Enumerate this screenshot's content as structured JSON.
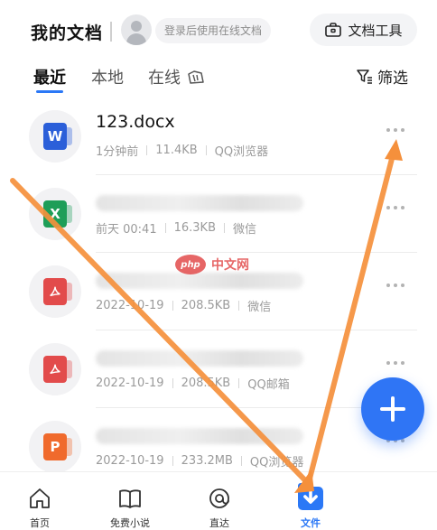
{
  "header": {
    "title": "我的文档",
    "login_prompt": "登录后使用在线文档",
    "tools_label": "文档工具"
  },
  "tabs": {
    "recent": "最近",
    "local": "本地",
    "online": "在线",
    "filter_label": "筛选"
  },
  "files": [
    {
      "icon": "word-doc-icon",
      "type_letter": "W",
      "color": "#2b5fd9",
      "name": "123.docx",
      "time": "1分钟前",
      "size": "11.4KB",
      "source": "QQ浏览器"
    },
    {
      "icon": "excel-sheet-icon",
      "type_letter": "X",
      "color": "#1e9e58",
      "name": "",
      "time": "前天 00:41",
      "size": "16.3KB",
      "source": "微信"
    },
    {
      "icon": "pdf-file-icon",
      "type_letter": "",
      "color": "#e24b4b",
      "name": "",
      "time": "2022-10-19",
      "size": "208.5KB",
      "source": "微信"
    },
    {
      "icon": "pdf-file-icon",
      "type_letter": "",
      "color": "#e24b4b",
      "name": "",
      "time": "2022-10-19",
      "size": "208.5KB",
      "source": "QQ邮箱"
    },
    {
      "icon": "ppt-file-icon",
      "type_letter": "P",
      "color": "#f06a2c",
      "name": "",
      "time": "2022-10-19",
      "size": "233.2MB",
      "source": "QQ浏览器"
    }
  ],
  "bottom_nav": {
    "home": "首页",
    "novel": "免费小说",
    "zhida": "直达",
    "files": "文件"
  },
  "watermark": {
    "badge": "php",
    "text": "中文网"
  },
  "colors": {
    "accent": "#2b78f6",
    "arrow": "#f5903c"
  }
}
